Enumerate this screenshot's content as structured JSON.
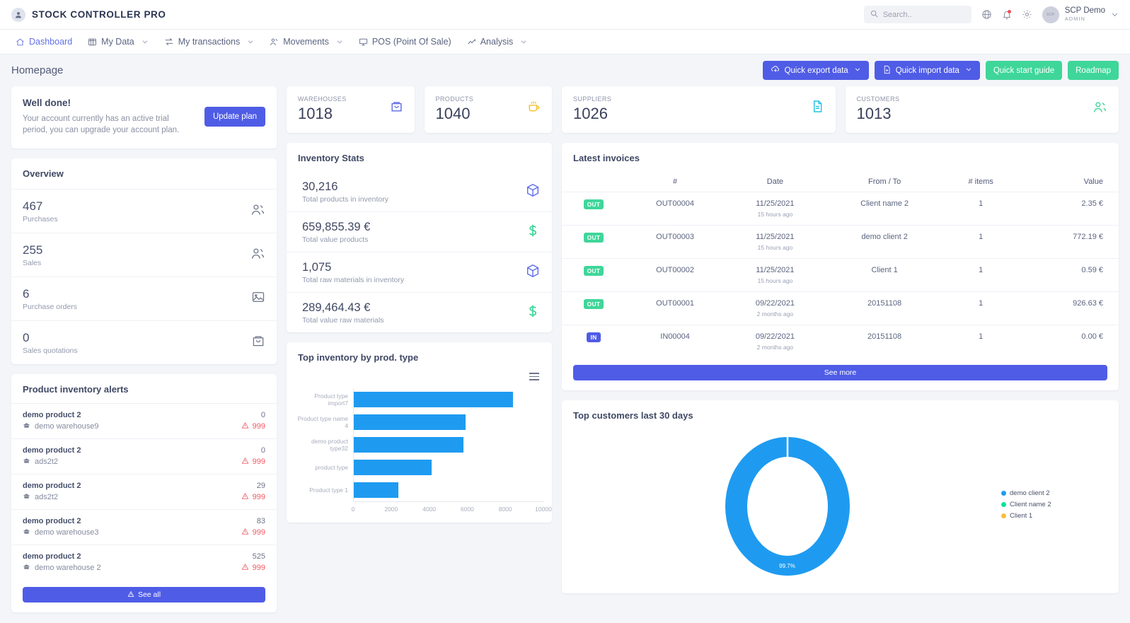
{
  "header": {
    "brand": "STOCK CONTROLLER PRO",
    "brand_icon": "user-circle-icon",
    "search": {
      "placeholder": "Search..",
      "value": "",
      "icon": "search-icon"
    },
    "icons": [
      "globe-icon",
      "bell-icon",
      "gear-icon"
    ],
    "user": {
      "name": "SCP Demo",
      "role": "ADMIN",
      "avatar_text": "SCP"
    }
  },
  "nav": {
    "items": [
      {
        "label": "Dashboard",
        "icon": "home-icon",
        "active": true,
        "caret": false
      },
      {
        "label": "My Data",
        "icon": "database-icon",
        "active": false,
        "caret": true
      },
      {
        "label": "My transactions",
        "icon": "transfer-icon",
        "active": false,
        "caret": true
      },
      {
        "label": "Movements",
        "icon": "movements-icon",
        "active": false,
        "caret": true
      },
      {
        "label": "POS (Point Of Sale)",
        "icon": "monitor-icon",
        "active": false,
        "caret": false
      },
      {
        "label": "Analysis",
        "icon": "chart-line-icon",
        "active": false,
        "caret": true
      }
    ]
  },
  "page": {
    "title": "Homepage",
    "actions": [
      {
        "label": "Quick export data",
        "style": "indigo",
        "icon": "cloud-download-icon",
        "caret": true
      },
      {
        "label": "Quick import data",
        "style": "indigo",
        "icon": "file-plus-icon",
        "caret": true
      },
      {
        "label": "Quick start guide",
        "style": "green",
        "icon": "",
        "caret": false
      },
      {
        "label": "Roadmap",
        "style": "green",
        "icon": "",
        "caret": false
      }
    ]
  },
  "trial": {
    "title": "Well done!",
    "text": "Your account currently has an active trial period, you can upgrade your account plan.",
    "button": "Update plan"
  },
  "overview": {
    "title": "Overview",
    "rows": [
      {
        "value": "467",
        "label": "Purchases",
        "icon": "users-icon"
      },
      {
        "value": "255",
        "label": "Sales",
        "icon": "users-icon"
      },
      {
        "value": "6",
        "label": "Purchase orders",
        "icon": "image-icon"
      },
      {
        "value": "0",
        "label": "Sales quotations",
        "icon": "bag-icon"
      }
    ]
  },
  "alerts": {
    "title": "Product inventory alerts",
    "see_all": "See all",
    "rows": [
      {
        "product": "demo product 2",
        "warehouse": "demo warehouse9",
        "qty": "0",
        "min": "999"
      },
      {
        "product": "demo product 2",
        "warehouse": "ads2t2",
        "qty": "0",
        "min": "999"
      },
      {
        "product": "demo product 2",
        "warehouse": "ads2t2",
        "qty": "29",
        "min": "999"
      },
      {
        "product": "demo product 2",
        "warehouse": "demo warehouse3",
        "qty": "83",
        "min": "999"
      },
      {
        "product": "demo product 2",
        "warehouse": "demo warehouse 2",
        "qty": "525",
        "min": "999"
      }
    ]
  },
  "stats": [
    {
      "key": "WAREHOUSES",
      "value": "1018",
      "icon": "bag-icon",
      "color": "#5b6ae8"
    },
    {
      "key": "PRODUCTS",
      "value": "1040",
      "icon": "cup-icon",
      "color": "#f5bf2a"
    },
    {
      "key": "SUPPLIERS",
      "value": "1026",
      "icon": "document-icon",
      "color": "#23c0e8"
    },
    {
      "key": "CUSTOMERS",
      "value": "1013",
      "icon": "users-icon",
      "color": "#3fd69a"
    }
  ],
  "inventory_stats": {
    "title": "Inventory Stats",
    "rows": [
      {
        "value": "30,216",
        "label": "Total products in inventory",
        "icon": "box-icon",
        "color": "#5b6ae8"
      },
      {
        "value": "659,855.39 €",
        "label": "Total value products",
        "icon": "dollar-icon",
        "color": "#3fd69a"
      },
      {
        "value": "1,075",
        "label": "Total raw materials in inventory",
        "icon": "box-icon",
        "color": "#5b6ae8"
      },
      {
        "value": "289,464.43 €",
        "label": "Total value raw materials",
        "icon": "dollar-icon",
        "color": "#3fd69a"
      }
    ]
  },
  "invoices": {
    "title": "Latest invoices",
    "columns": [
      "",
      "#",
      "Date",
      "From / To",
      "# items",
      "Value"
    ],
    "see_more": "See more",
    "rows": [
      {
        "type": "OUT",
        "number": "OUT00004",
        "date": "11/25/2021",
        "ago": "15 hours ago",
        "party": "Client name 2",
        "items": "1",
        "value": "2.35 €"
      },
      {
        "type": "OUT",
        "number": "OUT00003",
        "date": "11/25/2021",
        "ago": "15 hours ago",
        "party": "demo client 2",
        "items": "1",
        "value": "772.19 €"
      },
      {
        "type": "OUT",
        "number": "OUT00002",
        "date": "11/25/2021",
        "ago": "15 hours ago",
        "party": "Client 1",
        "items": "1",
        "value": "0.59 €"
      },
      {
        "type": "OUT",
        "number": "OUT00001",
        "date": "09/22/2021",
        "ago": "2 months ago",
        "party": "20151108",
        "items": "1",
        "value": "926.63 €"
      },
      {
        "type": "IN",
        "number": "IN00004",
        "date": "09/22/2021",
        "ago": "2 months ago",
        "party": "20151108",
        "items": "1",
        "value": "0.00 €"
      }
    ]
  },
  "chart_data": [
    {
      "type": "bar",
      "title": "Top inventory by prod. type",
      "orientation": "horizontal",
      "categories": [
        "Product type import7",
        "Product type name 4",
        "demo product type32",
        "product type",
        "Product type 1"
      ],
      "values": [
        8400,
        5900,
        5800,
        4100,
        2350
      ],
      "xlabel": "",
      "ylabel": "",
      "xlim": [
        0,
        10000
      ],
      "xticks": [
        0,
        2000,
        4000,
        6000,
        8000,
        10000
      ],
      "grid": false,
      "legend": "none",
      "series_color": "#1e9bf0",
      "menu_icon": "hamburger-icon"
    },
    {
      "type": "pie",
      "variant": "donut",
      "title": "Top customers last 30 days",
      "labels": [
        "demo client 2",
        "Client name 2",
        "Client 1"
      ],
      "values": [
        99.7,
        0.2,
        0.1
      ],
      "data_labels": [
        "99.7%"
      ],
      "colors": [
        "#1e9bf0",
        "#00e396",
        "#febc3b"
      ],
      "legend": "right"
    }
  ]
}
